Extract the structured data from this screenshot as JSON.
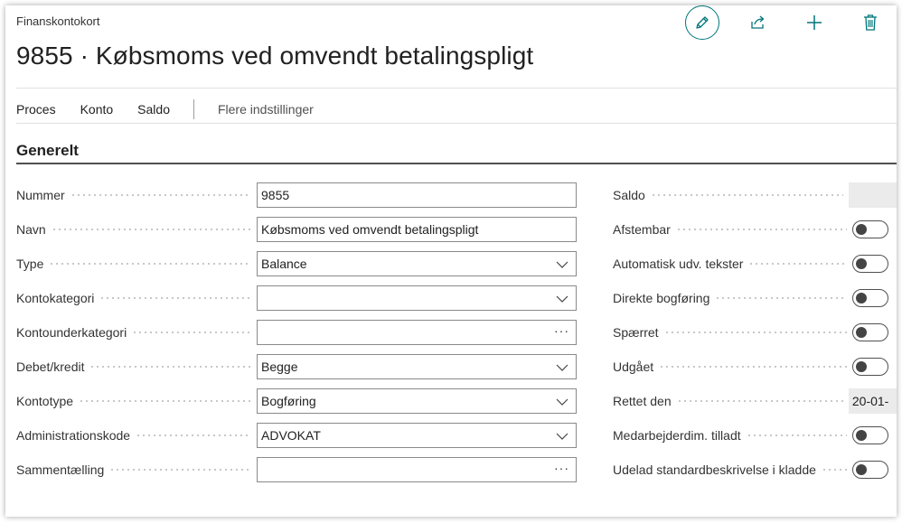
{
  "header": {
    "breadcrumb": "Finanskontokort",
    "title": "9855 · Købsmoms ved omvendt betalingspligt"
  },
  "actions": {
    "edit_icon": "pencil-icon",
    "share_icon": "share-icon",
    "add_icon": "plus-icon",
    "delete_icon": "trash-icon",
    "accent_color": "#00757a"
  },
  "menu": {
    "items": [
      "Proces",
      "Konto",
      "Saldo"
    ],
    "more": "Flere indstillinger"
  },
  "section": {
    "title": "Generelt"
  },
  "left_fields": [
    {
      "label": "Nummer",
      "value": "9855",
      "kind": "text"
    },
    {
      "label": "Navn",
      "value": "Købsmoms ved omvendt betalingspligt",
      "kind": "text"
    },
    {
      "label": "Type",
      "value": "Balance",
      "kind": "select"
    },
    {
      "label": "Kontokategori",
      "value": "",
      "kind": "select"
    },
    {
      "label": "Kontounderkategori",
      "value": "",
      "kind": "lookup"
    },
    {
      "label": "Debet/kredit",
      "value": "Begge",
      "kind": "select"
    },
    {
      "label": "Kontotype",
      "value": "Bogføring",
      "kind": "select"
    },
    {
      "label": "Administrationskode",
      "value": "ADVOKAT",
      "kind": "select"
    },
    {
      "label": "Sammentælling",
      "value": "",
      "kind": "lookup"
    }
  ],
  "right_fields": [
    {
      "label": "Saldo",
      "value": "",
      "kind": "readonly"
    },
    {
      "label": "Afstembar",
      "kind": "toggle",
      "on": false
    },
    {
      "label": "Automatisk udv. tekster",
      "kind": "toggle",
      "on": false
    },
    {
      "label": "Direkte bogføring",
      "kind": "toggle",
      "on": false
    },
    {
      "label": "Spærret",
      "kind": "toggle",
      "on": false
    },
    {
      "label": "Udgået",
      "kind": "toggle",
      "on": false
    },
    {
      "label": "Rettet den",
      "value": "20-01-",
      "kind": "readonly"
    },
    {
      "label": "Medarbejderdim. tilladt",
      "kind": "toggle",
      "on": false
    },
    {
      "label": "Udelad standardbeskrivelse i kladde",
      "kind": "toggle",
      "on": false
    }
  ]
}
